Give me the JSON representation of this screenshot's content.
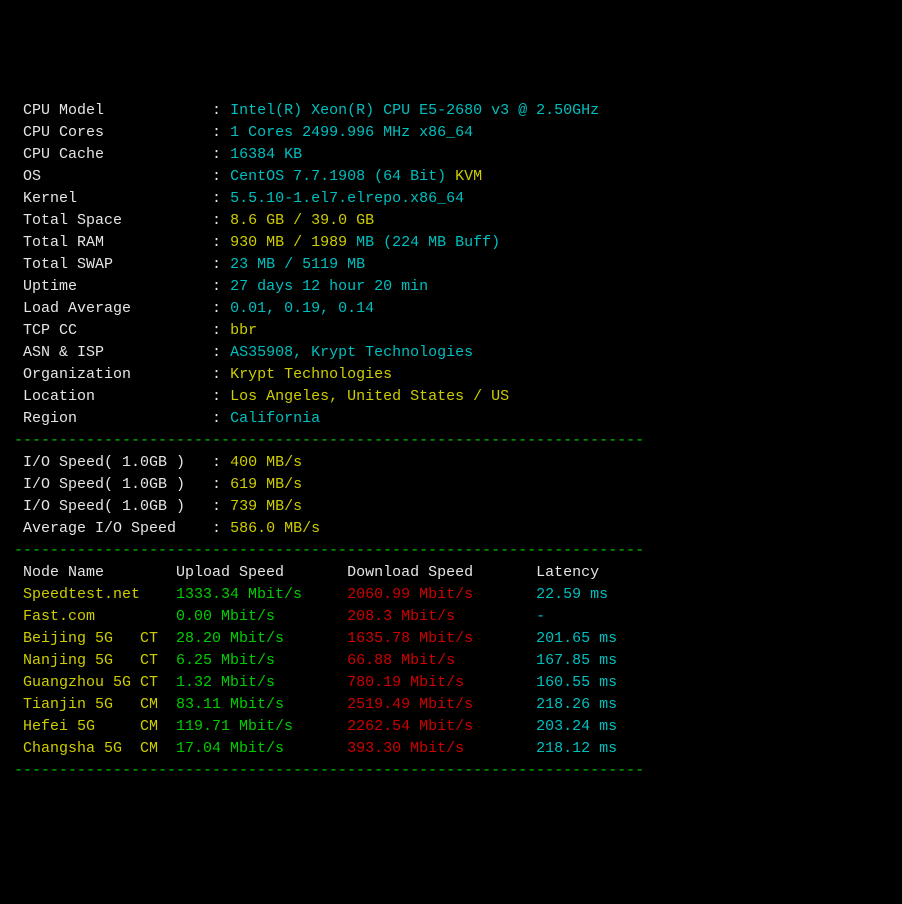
{
  "sysinfo": [
    {
      "label": "CPU Model",
      "val": "Intel(R) Xeon(R) CPU E5-2680 v3 @ 2.50GHz",
      "valClass": "cyan"
    },
    {
      "label": "CPU Cores",
      "val": "1 Cores 2499.996 MHz x86_64",
      "valClass": "cyan"
    },
    {
      "label": "CPU Cache",
      "val": "16384 KB",
      "valClass": "cyan"
    },
    {
      "label": "OS",
      "val": "CentOS 7.7.1908 (64 Bit)",
      "valClass": "cyan",
      "extra": " KVM",
      "extraClass": "yellow"
    },
    {
      "label": "Kernel",
      "val": "5.5.10-1.el7.elrepo.x86_64",
      "valClass": "cyan"
    },
    {
      "label": "Total Space",
      "val": "8.6 GB / 39.0 GB",
      "valClass": "yellow"
    },
    {
      "label": "Total RAM",
      "val": "930 MB / 1989",
      "valClass": "yellow",
      "extra": " MB (224 MB Buff)",
      "extraClass": "cyan"
    },
    {
      "label": "Total SWAP",
      "val": "23 MB / 5119 MB",
      "valClass": "cyan"
    },
    {
      "label": "Uptime",
      "val": "27 days 12 hour 20 min",
      "valClass": "cyan"
    },
    {
      "label": "Load Average",
      "val": "0.01, 0.19, 0.14",
      "valClass": "cyan"
    },
    {
      "label": "TCP CC",
      "val": "bbr",
      "valClass": "yellow"
    },
    {
      "label": "ASN & ISP",
      "val": "AS35908, Krypt Technologies",
      "valClass": "cyan"
    },
    {
      "label": "Organization",
      "val": "Krypt Technologies",
      "valClass": "yellow"
    },
    {
      "label": "Location",
      "val": "Los Angeles, United States / US",
      "valClass": "yellow"
    },
    {
      "label": "Region",
      "val": "California",
      "valClass": "cyan"
    }
  ],
  "io": [
    {
      "label": "I/O Speed( 1.0GB )",
      "val": "400 MB/s"
    },
    {
      "label": "I/O Speed( 1.0GB )",
      "val": "619 MB/s"
    },
    {
      "label": "I/O Speed( 1.0GB )",
      "val": "739 MB/s"
    },
    {
      "label": "Average I/O Speed",
      "val": "586.0 MB/s"
    }
  ],
  "speed_header": {
    "node": "Node Name",
    "up": "Upload Speed",
    "down": "Download Speed",
    "lat": "Latency"
  },
  "speed": [
    {
      "node": "Speedtest.net",
      "up": "1333.34 Mbit/s",
      "down": "2060.99 Mbit/s",
      "lat": "22.59 ms"
    },
    {
      "node": "Fast.com",
      "up": "0.00 Mbit/s",
      "down": "208.3 Mbit/s",
      "lat": "-"
    },
    {
      "node": "Beijing 5G   CT",
      "up": "28.20 Mbit/s",
      "down": "1635.78 Mbit/s",
      "lat": "201.65 ms"
    },
    {
      "node": "Nanjing 5G   CT",
      "up": "6.25 Mbit/s",
      "down": "66.88 Mbit/s",
      "lat": "167.85 ms"
    },
    {
      "node": "Guangzhou 5G CT",
      "up": "1.32 Mbit/s",
      "down": "780.19 Mbit/s",
      "lat": "160.55 ms"
    },
    {
      "node": "Tianjin 5G   CM",
      "up": "83.11 Mbit/s",
      "down": "2519.49 Mbit/s",
      "lat": "218.26 ms"
    },
    {
      "node": "Hefei 5G     CM",
      "up": "119.71 Mbit/s",
      "down": "2262.54 Mbit/s",
      "lat": "203.24 ms"
    },
    {
      "node": "Changsha 5G  CM",
      "up": "17.04 Mbit/s",
      "down": "393.30 Mbit/s",
      "lat": "218.12 ms"
    }
  ],
  "divider": "----------------------------------------------------------------------"
}
